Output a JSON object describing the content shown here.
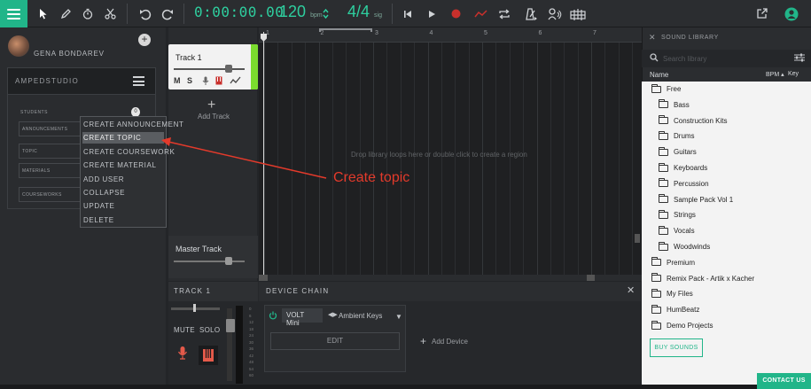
{
  "toolbar": {
    "time": "0:00:00.00",
    "bpm_value": "120",
    "bpm_unit": "bpm",
    "signature_value": "4/4",
    "signature_unit": "sig",
    "accent_color": "#21b589"
  },
  "sidebar": {
    "username": "GENA BONDAREV",
    "class_name": "AMPEDSTUDIO",
    "students_label": "STUDENTS",
    "students_count": "0",
    "rows": [
      "ANNOUNCEMENTS",
      "TOPIC",
      "MATERIALS",
      "COURSEWORKS"
    ]
  },
  "context_menu": {
    "items": [
      "CREATE ANNOUNCEMENT",
      "CREATE TOPIC",
      "CREATE COURSEWORK",
      "CREATE MATERIAL",
      "ADD USER",
      "COLLAPSE",
      "UPDATE",
      "DELETE"
    ],
    "selected": "CREATE TOPIC"
  },
  "tracks": {
    "track1_name": "Track 1",
    "mute_btn": "M",
    "solo_btn": "S",
    "add_track_label": "Add Track",
    "master_name": "Master Track",
    "track1_color": "#7bdc2e"
  },
  "arrange": {
    "ruler": [
      "1",
      "2",
      "3",
      "4",
      "5",
      "6",
      "7"
    ],
    "drop_hint": "Drop library loops here or double click to create a region"
  },
  "annotation": {
    "text": "Create topic",
    "color": "#e33a2b"
  },
  "track_strip": {
    "title": "TRACK 1",
    "mute_label": "MUTE",
    "solo_label": "SOLO",
    "meter_scale": [
      "0",
      "6",
      "12",
      "18",
      "24",
      "30",
      "36",
      "42",
      "48",
      "54",
      "60"
    ]
  },
  "device_chain": {
    "title": "DEVICE CHAIN",
    "device_name": "VOLT Mini",
    "preset": "Ambient Keys",
    "edit_label": "EDIT",
    "add_device_label": "Add Device"
  },
  "library": {
    "title": "SOUND LIBRARY",
    "search_placeholder": "Search library",
    "col_name": "Name",
    "col_bpm": "BPM",
    "col_key": "Key",
    "items": [
      {
        "label": "Free",
        "indent": 0
      },
      {
        "label": "Bass",
        "indent": 1
      },
      {
        "label": "Construction Kits",
        "indent": 1
      },
      {
        "label": "Drums",
        "indent": 1
      },
      {
        "label": "Guitars",
        "indent": 1
      },
      {
        "label": "Keyboards",
        "indent": 1
      },
      {
        "label": "Percussion",
        "indent": 1
      },
      {
        "label": "Sample Pack Vol 1",
        "indent": 1
      },
      {
        "label": "Strings",
        "indent": 1
      },
      {
        "label": "Vocals",
        "indent": 1
      },
      {
        "label": "Woodwinds",
        "indent": 1
      },
      {
        "label": "Premium",
        "indent": 0
      },
      {
        "label": "Remix Pack - Artik x Kacher",
        "indent": 0
      },
      {
        "label": "My Files",
        "indent": 0
      },
      {
        "label": "HumBeatz",
        "indent": 0
      },
      {
        "label": "Demo Projects",
        "indent": 0
      }
    ],
    "buy_sounds": "BUY SOUNDS",
    "contact_us": "CONTACT US"
  }
}
